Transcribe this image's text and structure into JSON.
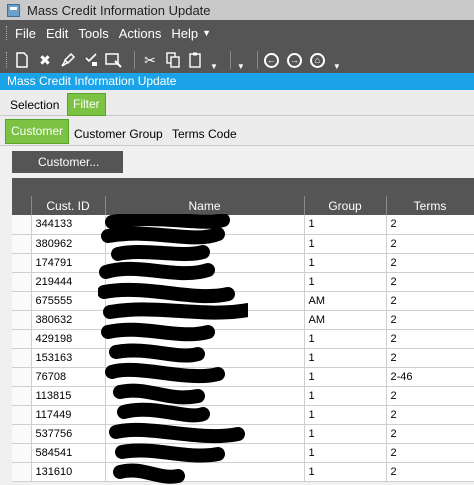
{
  "window": {
    "title": "Mass Credit Information Update"
  },
  "menu": {
    "items": [
      "File",
      "Edit",
      "Tools",
      "Actions",
      "Help"
    ]
  },
  "header": {
    "title": "Mass Credit Information Update"
  },
  "tabs_top": {
    "selection": "Selection",
    "filter": "Filter"
  },
  "tabs_sub": {
    "customer": "Customer",
    "customer_group": "Customer Group",
    "terms_code": "Terms Code"
  },
  "customer_button": "Customer...",
  "grid": {
    "columns": [
      "Cust. ID",
      "Name",
      "Group",
      "Terms"
    ],
    "rows": [
      {
        "id": "344133",
        "group": "1",
        "terms": "2"
      },
      {
        "id": "380962",
        "group": "1",
        "terms": "2"
      },
      {
        "id": "174791",
        "group": "1",
        "terms": "2"
      },
      {
        "id": "219444",
        "group": "1",
        "terms": "2"
      },
      {
        "id": "675555",
        "group": "AM",
        "terms": "2"
      },
      {
        "id": "380632",
        "group": "AM",
        "terms": "2"
      },
      {
        "id": "429198",
        "group": "1",
        "terms": "2"
      },
      {
        "id": "153163",
        "group": "1",
        "terms": "2"
      },
      {
        "id": "76708",
        "group": "1",
        "terms": "2-46"
      },
      {
        "id": "113815",
        "group": "1",
        "terms": "2"
      },
      {
        "id": "117449",
        "group": "1",
        "terms": "2"
      },
      {
        "id": "537756",
        "group": "1",
        "terms": "2"
      },
      {
        "id": "584541",
        "group": "1",
        "terms": "2"
      },
      {
        "id": "131610",
        "group": "1",
        "terms": "2"
      }
    ]
  }
}
